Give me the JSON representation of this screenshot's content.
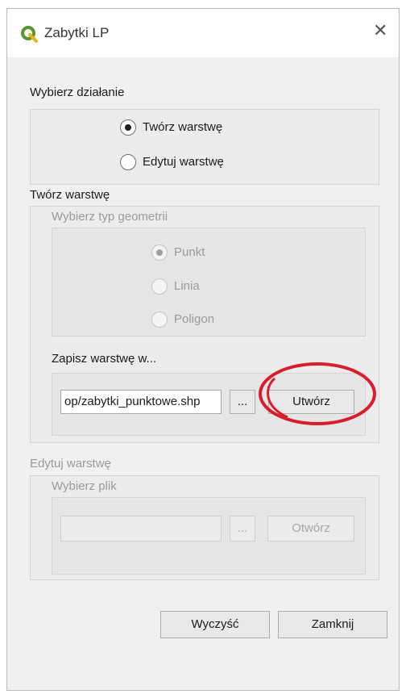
{
  "window": {
    "title": "Zabytki LP",
    "logo_icon": "qgis-logo-icon",
    "close_icon": "close-icon"
  },
  "action_group": {
    "title": "Wybierz działanie",
    "options": [
      {
        "label": "Twórz warstwę",
        "checked": true
      },
      {
        "label": "Edytuj warstwę",
        "checked": false
      }
    ]
  },
  "create_group": {
    "title": "Twórz warstwę",
    "geometry": {
      "title": "Wybierz typ geometrii",
      "options": [
        {
          "label": "Punkt",
          "checked": true
        },
        {
          "label": "Linia",
          "checked": false
        },
        {
          "label": "Poligon",
          "checked": false
        }
      ]
    },
    "save": {
      "title": "Zapisz warstwę w...",
      "path_value": "op/zabytki_punktowe.shp",
      "browse_label": "...",
      "create_label": "Utwórz"
    }
  },
  "edit_group": {
    "title": "Edytuj warstwę",
    "file": {
      "title": "Wybierz plik",
      "path_value": "",
      "browse_label": "...",
      "open_label": "Otwórz"
    }
  },
  "footer": {
    "clear_label": "Wyczyść",
    "close_label": "Zamknij"
  },
  "colors": {
    "annotation_circle": "#d81e2c",
    "qgis_green": "#589632",
    "qgis_yellow": "#eeb211"
  }
}
